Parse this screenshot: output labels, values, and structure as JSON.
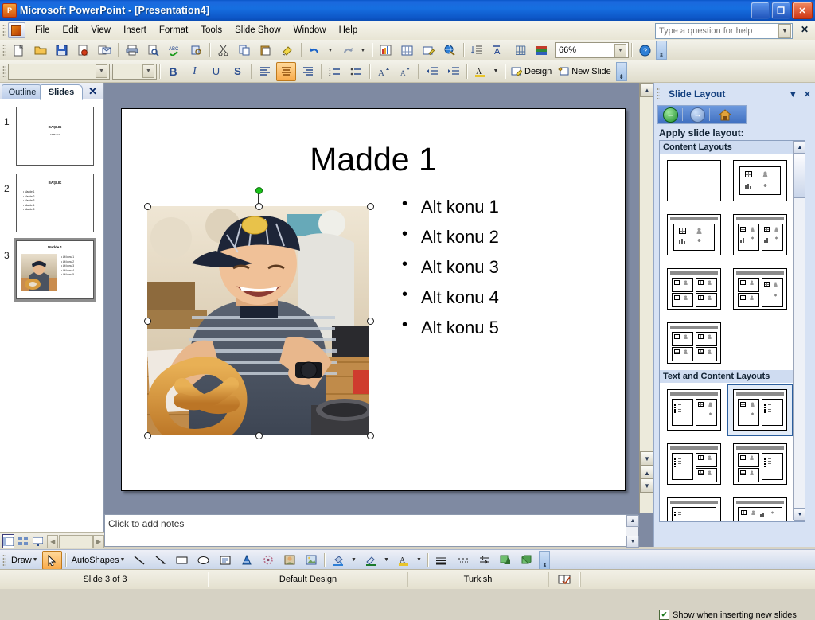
{
  "window": {
    "app_title": "Microsoft PowerPoint  - [Presentation4]",
    "app_icon": "powerpoint-icon",
    "minimize": "_",
    "restore": "❐",
    "close": "✕"
  },
  "menu": {
    "items": [
      "File",
      "Edit",
      "View",
      "Insert",
      "Format",
      "Tools",
      "Slide Show",
      "Window",
      "Help"
    ]
  },
  "help": {
    "placeholder": "Type a question for help",
    "close_label": "✕"
  },
  "toolbars": {
    "standard": [
      {
        "name": "new-icon",
        "glyph": "🗋"
      },
      {
        "name": "open-icon",
        "glyph": "📂"
      },
      {
        "name": "save-icon",
        "glyph": "💾"
      },
      {
        "name": "permission-icon",
        "glyph": "🖺"
      },
      {
        "name": "email-icon",
        "glyph": "📧"
      },
      {
        "name": "print-icon",
        "glyph": "🖨"
      },
      {
        "name": "print-preview-icon",
        "glyph": "🔍"
      },
      {
        "name": "spelling-icon",
        "glyph": "ABC"
      },
      {
        "name": "research-icon",
        "glyph": "📖"
      },
      {
        "name": "cut-icon",
        "glyph": "✂"
      },
      {
        "name": "copy-icon",
        "glyph": "⧉"
      },
      {
        "name": "paste-icon",
        "glyph": "📋"
      },
      {
        "name": "format-painter-icon",
        "glyph": "🖌"
      },
      {
        "name": "undo-icon",
        "glyph": "↩"
      },
      {
        "name": "redo-icon",
        "glyph": "↪"
      },
      {
        "name": "insert-chart-icon",
        "glyph": "📊"
      },
      {
        "name": "insert-table-icon",
        "glyph": "▦"
      },
      {
        "name": "tables-borders-icon",
        "glyph": "📝"
      },
      {
        "name": "insert-hyperlink-icon",
        "glyph": "🌐"
      },
      {
        "name": "expand-all-icon",
        "glyph": "↓≡"
      },
      {
        "name": "show-formatting-icon",
        "glyph": "A"
      },
      {
        "name": "show-grid-icon",
        "glyph": "▩"
      },
      {
        "name": "color-grayscale-icon",
        "glyph": "▤"
      }
    ],
    "zoom_value": "66%",
    "help_icon": "help-icon",
    "formatting": {
      "font_name": "",
      "font_size": "",
      "bold": "B",
      "italic": "I",
      "underline": "U",
      "shadow": "S",
      "align_left": "≡",
      "align_center": "≡",
      "align_right": "≡",
      "numbering": "1≡",
      "bullets": "•≡",
      "increase_font": "A",
      "decrease_font": "A",
      "decrease_indent": "⇤",
      "increase_indent": "⇥",
      "font_color": "A",
      "design_label": "Design",
      "new_slide_label": "New Slide"
    }
  },
  "slides_panel": {
    "tabs": [
      {
        "label": "Outline",
        "selected": false
      },
      {
        "label": "Slides",
        "selected": true
      }
    ],
    "close_label": "✕",
    "thumbnails": [
      {
        "number": "1",
        "title": "BAŞLIK",
        "subtitle": "Alt Başlık",
        "bullets": [],
        "has_image": false,
        "selected": false
      },
      {
        "number": "2",
        "title": "BAŞLIK",
        "subtitle": "",
        "bullets": [
          "Madde 1",
          "Madde 2",
          "Madde 3",
          "Madde 4",
          "Madde 5"
        ],
        "has_image": false,
        "selected": false
      },
      {
        "number": "3",
        "title": "Madde 1",
        "subtitle": "",
        "bullets": [
          "Alt konu 1",
          "Alt konu 2",
          "Alt konu 3",
          "Alt konu 4",
          "Alt konu 5"
        ],
        "has_image": true,
        "selected": true
      }
    ]
  },
  "slide": {
    "title": "Madde 1",
    "bullets": [
      "Alt konu 1",
      "Alt konu 2",
      "Alt konu 3",
      "Alt konu 4",
      "Alt konu 5"
    ],
    "image_alt": "boy-with-pretzel-photo",
    "image_selected": true
  },
  "notes": {
    "placeholder": "Click to add notes"
  },
  "task_pane": {
    "title": "Slide Layout",
    "dropdown_label": "▼",
    "close_label": "✕",
    "nav": {
      "back": "back-icon",
      "forward": "forward-icon",
      "home": "home-icon"
    },
    "apply_label": "Apply slide layout:",
    "sections": [
      {
        "header": "Content Layouts",
        "layouts": [
          {
            "name": "blank",
            "title_bar": false,
            "cells": 0,
            "selected": false
          },
          {
            "name": "content",
            "title_bar": false,
            "cells": 1,
            "selected": false
          },
          {
            "name": "title-and-content",
            "title_bar": true,
            "cells": 1,
            "selected": false
          },
          {
            "name": "title-and-two-content",
            "title_bar": true,
            "cells": 2,
            "selected": false
          },
          {
            "name": "title-and-four-content",
            "title_bar": true,
            "cells": 4,
            "selected": false
          },
          {
            "name": "title-content-over-content",
            "title_bar": true,
            "cells": 3,
            "selected": false
          },
          {
            "name": "title-and-six-content",
            "title_bar": true,
            "cells": 6,
            "selected": false
          }
        ]
      },
      {
        "header": "Text and Content Layouts",
        "layouts": [
          {
            "name": "title-text-and-content",
            "title_bar": true,
            "cells": 2,
            "selected": false
          },
          {
            "name": "title-content-and-text",
            "title_bar": true,
            "cells": 2,
            "selected": true
          },
          {
            "name": "title-text-and-two-content",
            "title_bar": true,
            "cells": 3,
            "selected": false
          },
          {
            "name": "title-two-content-and-text",
            "title_bar": true,
            "cells": 3,
            "selected": false
          },
          {
            "name": "title-and-text-over-content",
            "title_bar": true,
            "cells": 2,
            "selected": false
          },
          {
            "name": "title-and-content-over-text",
            "title_bar": true,
            "cells": 2,
            "selected": false
          }
        ]
      }
    ],
    "show_checkbox": {
      "label": "Show when inserting new slides",
      "checked": true,
      "check_glyph": "✔"
    }
  },
  "view_bar": {
    "buttons": [
      {
        "name": "normal-view-button",
        "glyph": "▣",
        "selected": true
      },
      {
        "name": "slide-sorter-view-button",
        "glyph": "▤",
        "selected": false
      },
      {
        "name": "slide-show-button",
        "glyph": "▭",
        "selected": false
      }
    ]
  },
  "drawing_toolbar": {
    "draw_label": "Draw",
    "autoshapes_label": "AutoShapes",
    "tools": [
      {
        "name": "select-objects-icon",
        "glyph": "↖",
        "selected": true
      },
      {
        "name": "line-icon",
        "glyph": "╲"
      },
      {
        "name": "arrow-icon",
        "glyph": "↘"
      },
      {
        "name": "rectangle-icon",
        "glyph": "▭"
      },
      {
        "name": "oval-icon",
        "glyph": "◯"
      },
      {
        "name": "text-box-icon",
        "glyph": "▤"
      },
      {
        "name": "wordart-icon",
        "glyph": "◢"
      },
      {
        "name": "diagram-icon",
        "glyph": "◌"
      },
      {
        "name": "insert-clip-art-icon",
        "glyph": "▣"
      },
      {
        "name": "insert-picture-icon",
        "glyph": "▨"
      },
      {
        "name": "fill-color-icon",
        "glyph": "🪣"
      },
      {
        "name": "line-color-icon",
        "glyph": "🖉"
      },
      {
        "name": "font-color-icon",
        "glyph": "A"
      },
      {
        "name": "line-style-icon",
        "glyph": "≡"
      },
      {
        "name": "dash-style-icon",
        "glyph": "┄"
      },
      {
        "name": "arrow-style-icon",
        "glyph": "⇄"
      },
      {
        "name": "shadow-style-icon",
        "glyph": "◪"
      },
      {
        "name": "3d-style-icon",
        "glyph": "◰"
      }
    ]
  },
  "status_bar": {
    "slide_counter": "Slide 3 of 3",
    "design_name": "Default Design",
    "language": "Turkish",
    "spell_icon": "spell-check-icon"
  }
}
